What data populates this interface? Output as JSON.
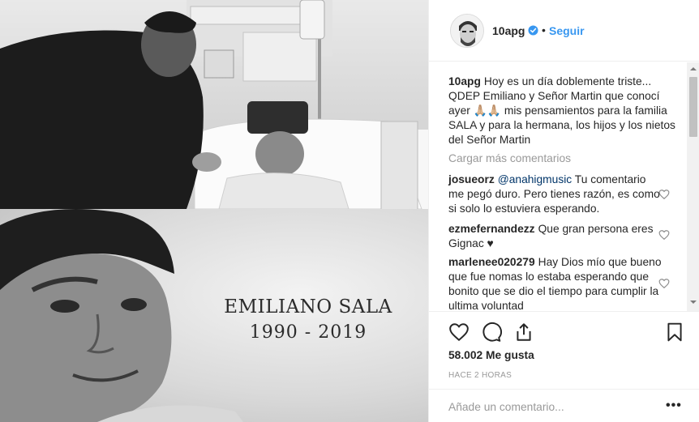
{
  "media": {
    "memorial_name": "EMILIANO SALA",
    "memorial_years": "1990 - 2019"
  },
  "header": {
    "username": "10apg",
    "separator": "•",
    "follow_label": "Seguir",
    "verified_icon": "verified-badge-icon",
    "accent": "#3897f0"
  },
  "caption": {
    "username": "10apg",
    "text": "Hoy es un día doblemente triste... QDEP Emiliano y Señor Martin que conocí ayer 🙏🏼🙏🏼 mis pensamientos para la familia SALA y para la hermana, los hijos y los nietos del Señor Martin"
  },
  "load_more_label": "Cargar más comentarios",
  "comments": [
    {
      "username": "josueorz",
      "mention": "@anahigmusic",
      "text": "Tu comentario me pegó duro. Pero tienes razón, es como si solo lo estuviera esperando."
    },
    {
      "username": "ezmefernandezz",
      "mention": "",
      "text": "Que gran persona eres Gignac ♥"
    },
    {
      "username": "marlenee020279",
      "mention": "",
      "text": "Hay Dios mío que bueno que fue nomas lo estaba esperando que bonito que se dio el tiempo para cumplir la ultima voluntad"
    }
  ],
  "actions": {
    "like_icon": "heart-icon",
    "comment_icon": "comment-bubble-icon",
    "share_icon": "share-icon",
    "save_icon": "bookmark-icon",
    "likes_text": "58.002 Me gusta",
    "time_text": "HACE 2 HORAS"
  },
  "add_comment": {
    "placeholder": "Añade un comentario...",
    "more_label": "•••"
  }
}
